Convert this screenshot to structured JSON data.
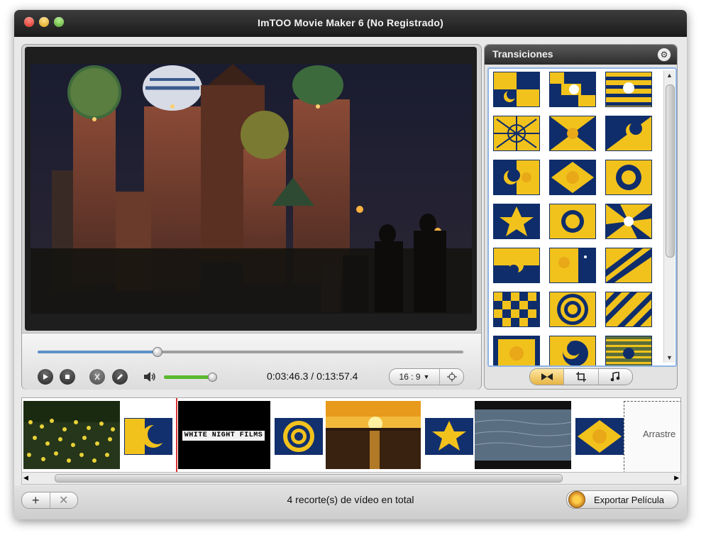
{
  "window": {
    "title": "ImTOO Movie Maker 6 (No Registrado)"
  },
  "player": {
    "progress": 0.28,
    "volume": 0.95,
    "time_current": "0:03:46.3",
    "time_separator": "/",
    "time_total": "0:13:57.4",
    "aspect_ratio": "16 : 9"
  },
  "transitions": {
    "title": "Transiciones",
    "tabs": [
      "transitions",
      "crop",
      "music"
    ]
  },
  "timeline": {
    "clip_titles": [
      "WHITE NIGHT FILMS"
    ],
    "drop_hint": "Arrastre"
  },
  "footer": {
    "status": "4 recorte(s) de vídeo en total",
    "export_label": "Exportar Película"
  },
  "colors": {
    "accent_blue": "#5e93c8",
    "volume_green": "#59b82e",
    "tile_yellow": "#f2c21c",
    "tile_navy": "#0f2d6a"
  }
}
